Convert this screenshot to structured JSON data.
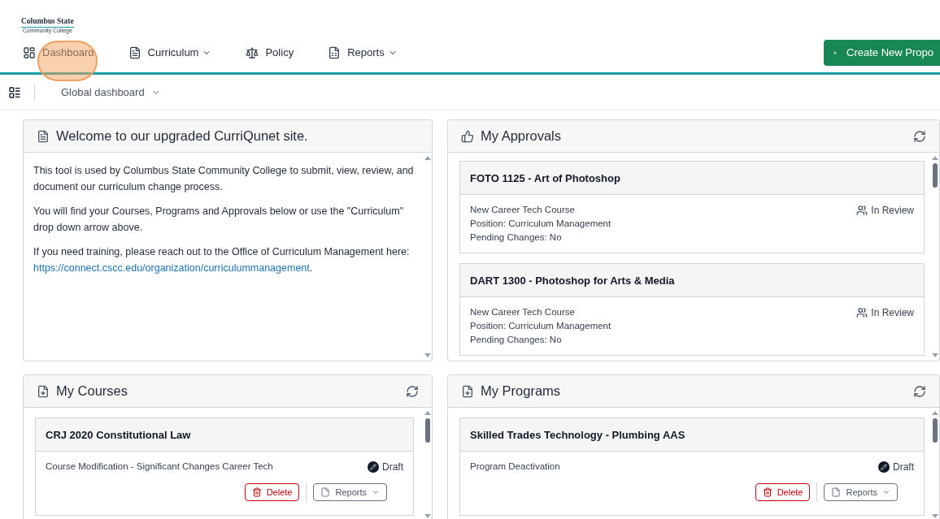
{
  "logo": {
    "name": "Columbus State",
    "subtitle": "Community College"
  },
  "nav": [
    {
      "label": "Dashboard",
      "kind": "dashboard",
      "dropdown": false
    },
    {
      "label": "Curriculum",
      "kind": "curriculum",
      "dropdown": true
    },
    {
      "label": "Policy",
      "kind": "policy",
      "dropdown": false
    },
    {
      "label": "Reports",
      "kind": "reports",
      "dropdown": true
    }
  ],
  "create_button": {
    "label": "Create New Propo"
  },
  "toolbar": {
    "dashboard_select": "Global dashboard"
  },
  "welcome": {
    "title": "Welcome to our upgraded CurriQunet site.",
    "paragraphs": [
      "This tool is used by Columbus State Community College to submit, view, review, and document our curriculum change process.",
      "You will find your Courses, Programs and Approvals below or use the \"Curriculum\" drop down arrow above."
    ],
    "training_text": "If you need training, please reach out to the Office of Curriculum Management here: ",
    "link": "https://connect.cscc.edu/organization/curriculummanagement",
    "after_link": "."
  },
  "approvals": {
    "title": "My Approvals",
    "items": [
      {
        "title": "FOTO 1125 - Art of Photoshop",
        "lines": [
          "New Career Tech Course",
          "Position: Curriculum Management",
          "Pending Changes: No"
        ],
        "status": "In Review",
        "kind": "review"
      },
      {
        "title": "DART 1300 - Photoshop for Arts & Media",
        "lines": [
          "New Career Tech Course",
          "Position: Curriculum Management",
          "Pending Changes: No"
        ],
        "status": "In Review",
        "kind": "review"
      }
    ]
  },
  "courses": {
    "title": "My Courses",
    "items": [
      {
        "title": "CRJ 2020 Constitutional Law",
        "lines": [
          "Course Modification - Significant Changes Career Tech"
        ],
        "status": "Draft",
        "kind": "draft",
        "delete": "Delete",
        "reports": "Reports"
      }
    ]
  },
  "programs": {
    "title": "My Programs",
    "items": [
      {
        "title": "Skilled Trades Technology - Plumbing AAS",
        "lines": [
          "Program Deactivation"
        ],
        "status": "Draft",
        "kind": "draft",
        "delete": "Delete",
        "reports": "Reports"
      }
    ]
  }
}
